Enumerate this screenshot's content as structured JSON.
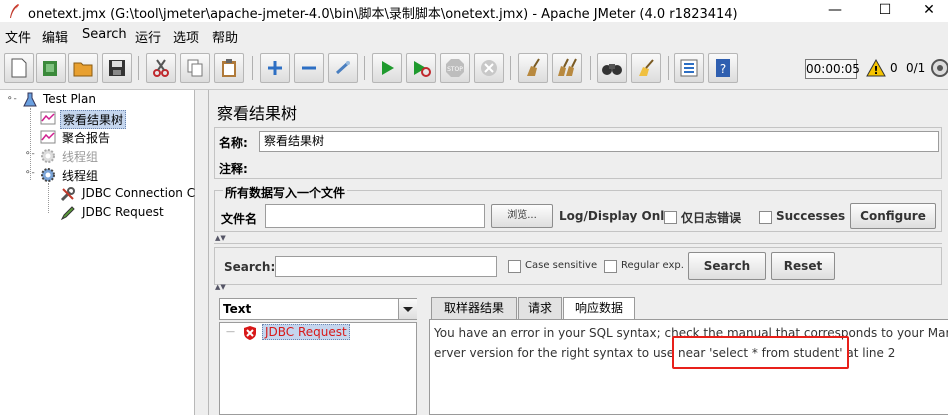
{
  "window": {
    "title": "onetext.jmx (G:\\tool\\jmeter\\apache-jmeter-4.0\\bin\\脚本\\录制脚本\\onetext.jmx) - Apache JMeter (4.0 r1823414)",
    "minimize": "—",
    "maximize": "☐",
    "close": "✕"
  },
  "menu": [
    "文件",
    "编辑",
    "Search",
    "运行",
    "选项",
    "帮助"
  ],
  "toolbar": {
    "timer": "00:00:05",
    "warnings": "0",
    "threads": "0/1"
  },
  "tree": {
    "test_plan": "Test Plan",
    "view_results_tree": "察看结果树",
    "aggregate_report": "聚合报告",
    "thread_group_disabled": "线程组",
    "thread_group": "线程组",
    "jdbc_connection": "JDBC Connection C",
    "jdbc_request": "JDBC Request"
  },
  "panel": {
    "title": "察看结果树",
    "name_label": "名称:",
    "name_value": "察看结果树",
    "comment_label": "注释:",
    "comment_value": "",
    "file_group_title": "所有数据写入一个文件",
    "filename_label": "文件名",
    "filename_value": "",
    "browse": "浏览...",
    "log_display": "Log/Display Only:",
    "errors_only": "仅日志错误",
    "successes": "Successes",
    "configure": "Configure"
  },
  "search": {
    "label": "Search:",
    "value": "",
    "case_sensitive": "Case sensitive",
    "regex": "Regular exp.",
    "search_btn": "Search",
    "reset_btn": "Reset"
  },
  "results": {
    "renderer": "Text",
    "sample": "JDBC Request",
    "tabs": [
      "取样器结果",
      "请求",
      "响应数据"
    ],
    "response_line1": "You have an error in your SQL syntax; check the manual that corresponds to your MariaDB s",
    "response_line2": "erver version for the right syntax to use near 'select * from student' at line 2"
  },
  "colors": {
    "highlight_box": "#e8201a",
    "selection": "#c5d6ee",
    "error_text": "#d81818"
  }
}
